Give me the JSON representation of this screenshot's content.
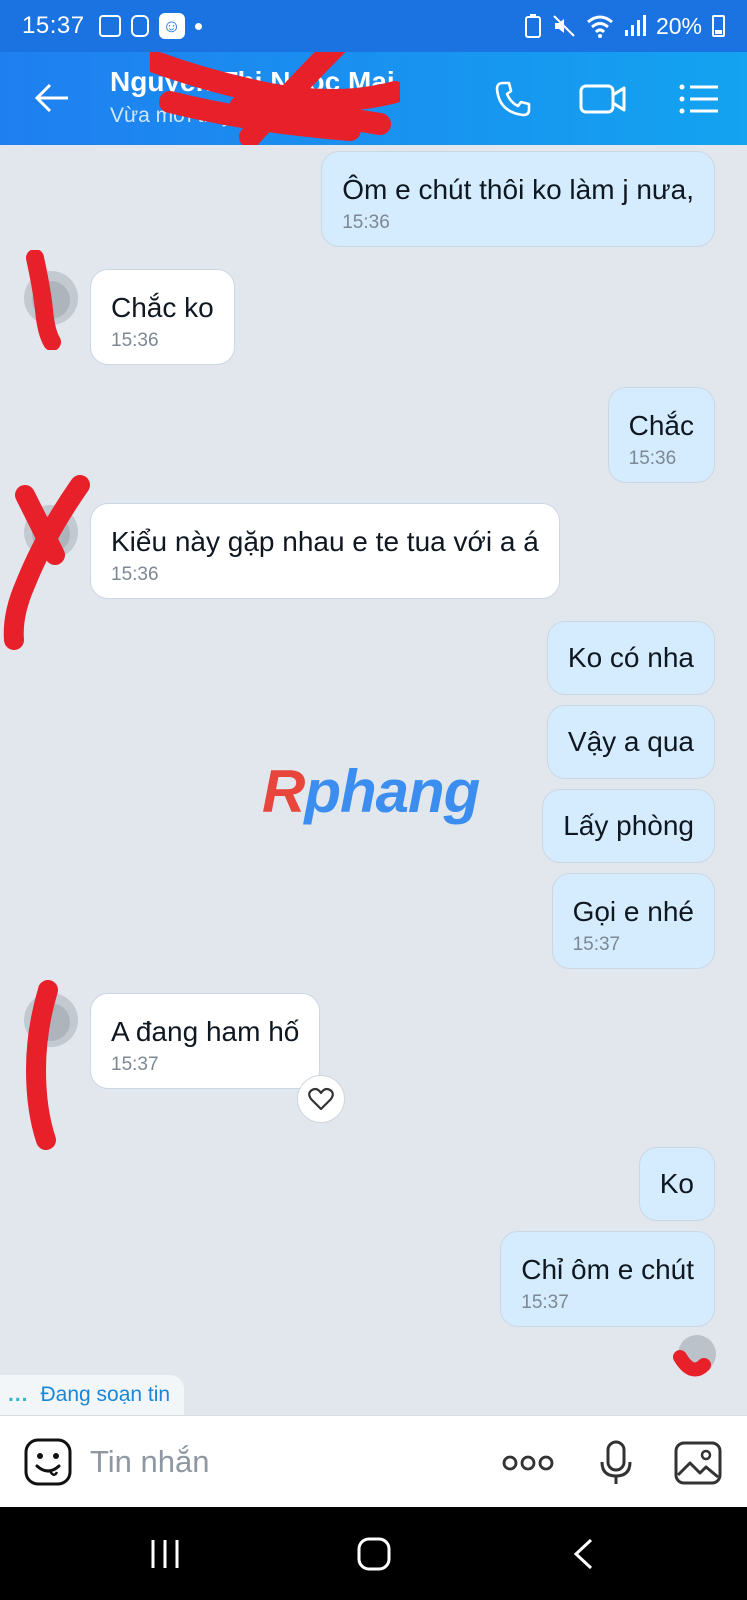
{
  "status_bar": {
    "time": "15:37",
    "battery": "20%"
  },
  "header": {
    "contact_name": "Nguyễn Thị Ngọc Mai",
    "contact_status": "Vừa mới truy cập"
  },
  "messages": [
    {
      "text": "Ôm e chút thôi ko làm j nưa,",
      "time": "15:36",
      "side": "out"
    },
    {
      "text": "Chắc ko",
      "time": "15:36",
      "side": "in"
    },
    {
      "text": "Chắc",
      "time": "15:36",
      "side": "out"
    },
    {
      "text": "Kiểu này gặp nhau e te tua với a á",
      "time": "15:36",
      "side": "in"
    },
    {
      "text": "Ko có nha",
      "side": "out"
    },
    {
      "text": "Vậy a qua",
      "side": "out"
    },
    {
      "text": "Lấy phòng",
      "side": "out"
    },
    {
      "text": "Gọi e nhé",
      "time": "15:37",
      "side": "out"
    },
    {
      "text": "A đang ham hố",
      "time": "15:37",
      "side": "in"
    },
    {
      "text": "Ko",
      "side": "out"
    },
    {
      "text": "Chỉ ôm e chút",
      "time": "15:37",
      "side": "out"
    }
  ],
  "watermark": {
    "first": "R",
    "rest": "phang"
  },
  "typing": {
    "dots": "...",
    "label": "Đang soạn tin"
  },
  "composer": {
    "placeholder": "Tin nhắn"
  },
  "colors": {
    "header_start": "#1f7ff0",
    "header_end": "#13a3f0",
    "outgoing_bubble": "#d4ecfd",
    "incoming_bubble": "#ffffff",
    "chat_bg": "#e2e7ee",
    "scribble": "#e8202a"
  }
}
